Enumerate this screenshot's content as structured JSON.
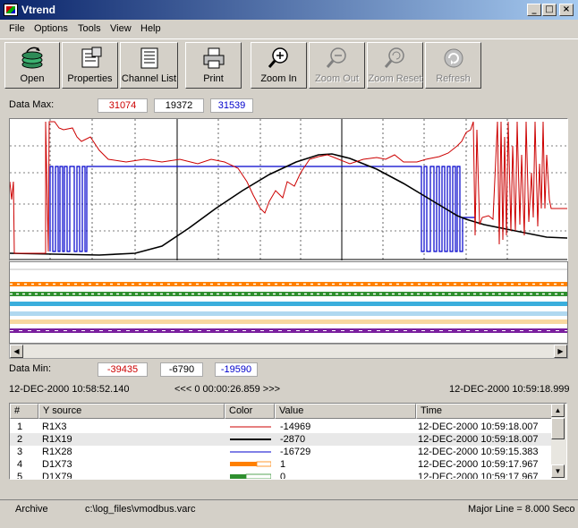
{
  "window": {
    "title": "Vtrend"
  },
  "menu": [
    "File",
    "Options",
    "Tools",
    "View",
    "Help"
  ],
  "toolbar": {
    "open": "Open",
    "properties": "Properties",
    "channel_list": "Channel List",
    "print": "Print",
    "zoom_in": "Zoom In",
    "zoom_out": "Zoom Out",
    "zoom_reset": "Zoom Reset",
    "refresh": "Refresh"
  },
  "data_max": {
    "label": "Data Max:",
    "values": [
      "31074",
      "19372",
      "31539"
    ]
  },
  "data_min": {
    "label": "Data Min:",
    "values": [
      "-39435",
      "-6790",
      "-19590"
    ]
  },
  "colors": {
    "r1x3": "#cc0000",
    "r1x19": "#000000",
    "r1x28": "#0000cc",
    "d1x73": "#ff8000",
    "d1x79": "#2f8f2f"
  },
  "time": {
    "start": "12-DEC-2000 10:58:52.140",
    "span": "<<< 0 00:00:26.859 >>>",
    "end": "12-DEC-2000 10:59:18.999"
  },
  "table": {
    "headers": [
      "#",
      "Y source",
      "Color",
      "Value",
      "Time"
    ],
    "rows": [
      {
        "num": "1",
        "source": "R1X3",
        "color": "red-line",
        "value": "-14969",
        "time": "12-DEC-2000 10:59:18.007"
      },
      {
        "num": "2",
        "source": "R1X19",
        "color": "black-line",
        "value": "-2870",
        "time": "12-DEC-2000 10:59:18.007"
      },
      {
        "num": "3",
        "source": "R1X28",
        "color": "blue-line",
        "value": "-16729",
        "time": "12-DEC-2000 10:59:15.383"
      },
      {
        "num": "4",
        "source": "D1X73",
        "color": "orange-bar",
        "value": "1",
        "time": "12-DEC-2000 10:59:17.967"
      },
      {
        "num": "5",
        "source": "D1X79",
        "color": "green-bar",
        "value": "0",
        "time": "12-DEC-2000 10:59:17.967"
      }
    ]
  },
  "status": {
    "archive_label": "Archive",
    "file": "c:\\log_files\\vmodbus.varc",
    "major_line": "Major Line = 8.000 Seco"
  }
}
